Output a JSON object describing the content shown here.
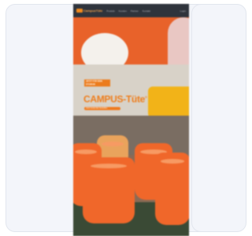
{
  "navbar": {
    "logo_text": "CampusTüte",
    "items": [
      "Produkt",
      "Kunden",
      "Partner",
      "Kontakt"
    ],
    "extra": "Login"
  },
  "hero": {
    "badge_line_1": "JETZT FÜR DEIN",
    "badge_line_2": "STUDIUM",
    "title": "CAMPUS-Tüte",
    "trademark": "®",
    "cta_label": "Jetzt kostenlos bestellen"
  },
  "colors": {
    "accent": "#ef7a1e",
    "navbar_bg": "#2f343c"
  }
}
